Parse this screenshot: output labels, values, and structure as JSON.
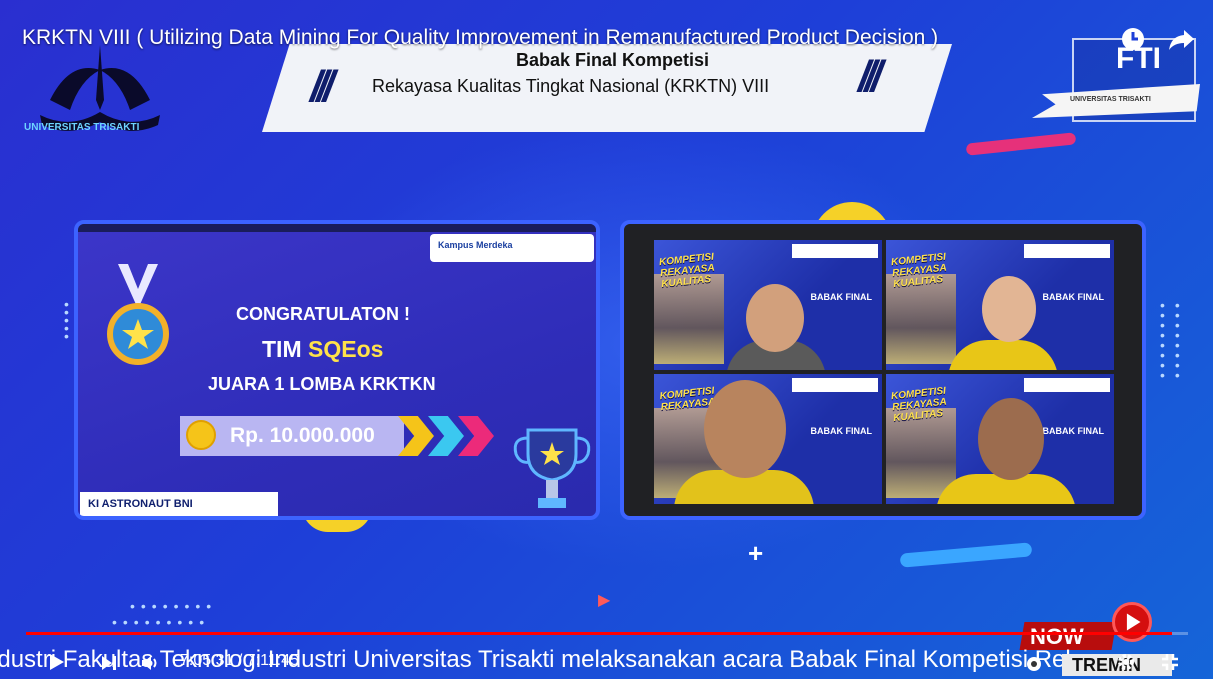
{
  "video": {
    "title": "KRKTN VIII ( Utilizing Data Mining For Quality Improvement in Remanufactured Product Decision )",
    "current_time": "7:05:31",
    "duration": "7:11:45",
    "time_display": "7:05:31 / 7:11:45",
    "progress_fraction": 0.986
  },
  "header": {
    "university_name": "UNIVERSITAS TRISAKTI",
    "banner_line1": "Babak Final Kompetisi",
    "banner_line2": "Rekayasa Kualitas Tingkat Nasional (KRKTN) VIII",
    "faculty_logo": "FTI",
    "faculty_sub": "UNIVERSITAS TRISAKTI"
  },
  "left_panel": {
    "sponsor_top": "Kampus Merdeka",
    "congrat": "CONGRATULATON !",
    "team_prefix": "TIM",
    "team_name": "SQEos",
    "award": "JUARA 1 LOMBA KRKTKN",
    "prize": "Rp. 10.000.000",
    "sponsor_bottom": "KI  ASTRONAUT  BNI"
  },
  "right_panel": {
    "tiles": [
      {
        "title": "KOMPETISI REKAYASA KUALITAS",
        "label": "BABAK FINAL"
      },
      {
        "title": "KOMPETISI REKAYASA KUALITAS",
        "label": "BABAK FINAL"
      },
      {
        "title": "KOMPETISI REKAYASA",
        "label": "BABAK FINAL"
      },
      {
        "title": "KOMPETISI REKAYASA KUALITAS",
        "label": "BABAK FINAL"
      }
    ]
  },
  "ticker": {
    "text": "ndustri Fakultas Teknologi Industri Universitas Trisakti melaksanakan acara Babak Final Kompetisi Rek"
  },
  "overlay": {
    "now_label": "NOW",
    "trem_label": "TREMIN"
  },
  "colors": {
    "background": "#1e3fd8",
    "accent_yellow": "#ffe24a",
    "progress_red": "#ff0000",
    "panel_border": "#3c63ff"
  },
  "icons": {
    "clock": "clock-icon",
    "share": "share-icon",
    "play": "play-icon",
    "next": "next-icon",
    "volume": "volume-icon",
    "settings": "gear-icon",
    "fullscreen": "exit-fullscreen-icon"
  }
}
